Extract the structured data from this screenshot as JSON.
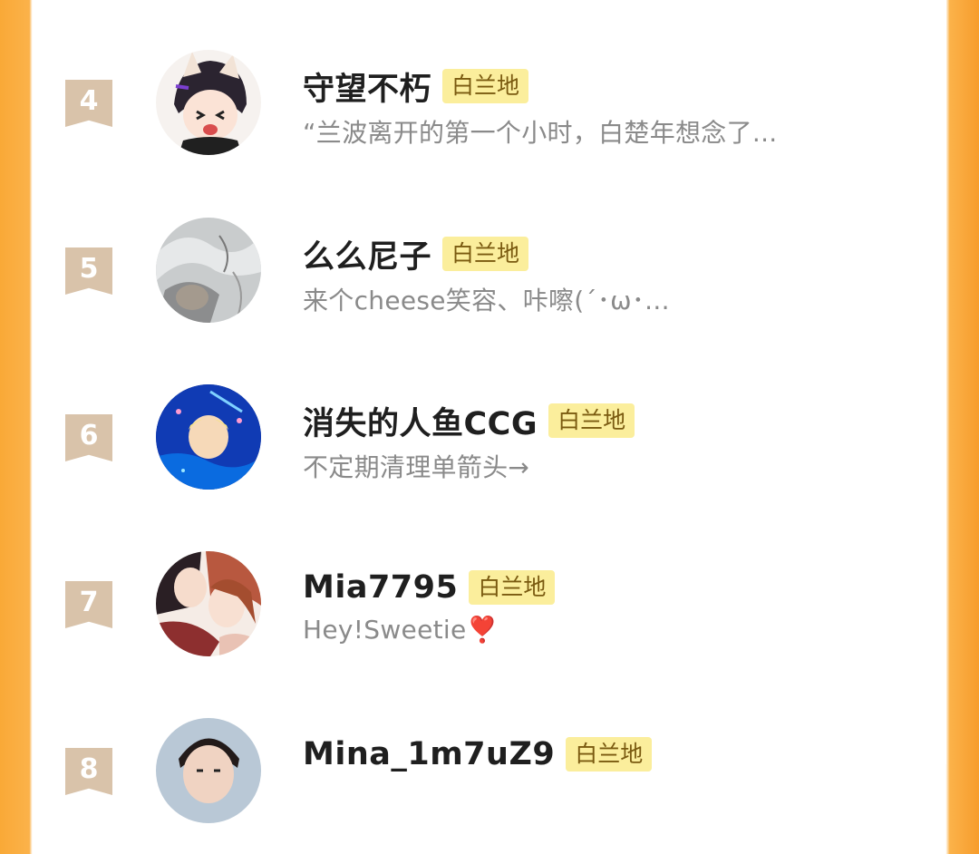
{
  "tag_label": "白兰地",
  "users": [
    {
      "rank": "4",
      "name": "守望不朽",
      "bio": "“兰波离开的第一个小时，白楚年想念了...",
      "bio_suffix": "",
      "avatar_icon": "anime-boy-cat-ears-avatar"
    },
    {
      "rank": "5",
      "name": "么么尼子",
      "bio": "来个cheese笑容、咔嚓(´･ω･...",
      "bio_suffix": "",
      "avatar_icon": "grey-sketch-avatar"
    },
    {
      "rank": "6",
      "name": "消失的人鱼CCG",
      "bio": "不定期清理单箭头→",
      "bio_suffix": "",
      "avatar_icon": "blue-mermaid-avatar"
    },
    {
      "rank": "7",
      "name": "Mia7795",
      "bio": "Hey!Sweetie",
      "bio_suffix": "❣️",
      "avatar_icon": "anime-couple-avatar"
    },
    {
      "rank": "8",
      "name": "Mina_1m7uZ9",
      "bio": "",
      "bio_suffix": "",
      "avatar_icon": "boy-portrait-avatar"
    }
  ]
}
